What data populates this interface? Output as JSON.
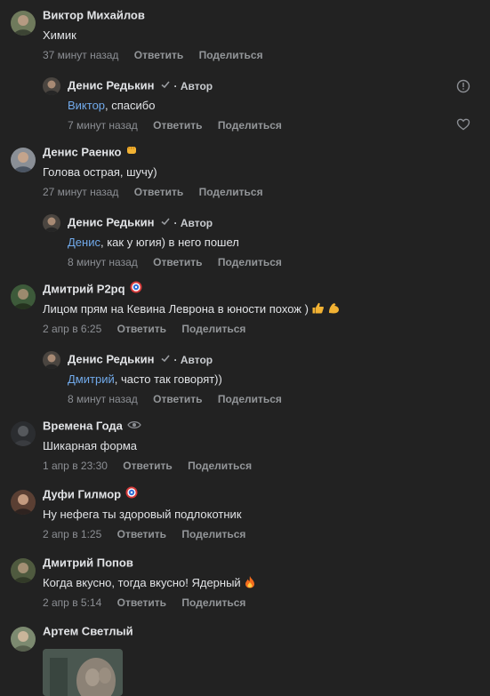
{
  "actions": {
    "reply": "Ответить",
    "share": "Поделиться"
  },
  "colors": {
    "background": "#222222",
    "text": "#e1e3e6",
    "meta": "#8c8f94",
    "mention": "#71aaeb"
  },
  "comments": [
    {
      "author": "Виктор Михайлов",
      "text": "Химик",
      "time": "37 минут назад"
    },
    {
      "author": "Денис Редькин",
      "role": "· Автор",
      "mention": "Виктор",
      "text": ", спасибо",
      "time": "7 минут назад",
      "icons": [
        "report-icon",
        "like-heart-icon"
      ]
    },
    {
      "author": "Денис Раенко",
      "badge": "fist-emoji",
      "text": "Голова острая, шучу)",
      "time": "27 минут назад"
    },
    {
      "author": "Денис Редькин",
      "role": "· Автор",
      "mention": "Денис",
      "text": ", как у югия) в него пошел",
      "time": "8 минут назад"
    },
    {
      "author": "Дмитрий P2pq",
      "badge": "captain-shield-emoji",
      "text": "Лицом прям на Кевина Леврона в юности похож )",
      "emojis": [
        "thumbs-up-emoji",
        "flexed-biceps-emoji"
      ],
      "time": "2 апр в 6:25"
    },
    {
      "author": "Денис Редькин",
      "role": "· Автор",
      "mention": "Дмитрий",
      "text": ", часто так говорят))",
      "time": "8 минут назад"
    },
    {
      "author": "Времена Года",
      "badge": "eye-emoji",
      "text": "Шикарная форма",
      "time": "1 апр в 23:30"
    },
    {
      "author": "Дуфи Гилмор",
      "badge": "captain-shield-emoji",
      "text": "Ну нефега ты здоровый подлокотник",
      "time": "2 апр в 1:25"
    },
    {
      "author": "Дмитрий Попов",
      "text": "Когда вкусно, тогда вкусно! Ядерный",
      "emojis": [
        "fire-emoji"
      ],
      "time": "2 апр в 5:14"
    },
    {
      "author": "Артем Светлый",
      "attachment": "photo-attachment"
    }
  ]
}
